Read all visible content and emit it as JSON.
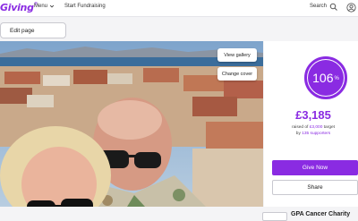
{
  "header": {
    "logo": "Giving",
    "menu_label": "Menu",
    "start_fundraising": "Start Fundraising",
    "search_label": "Search"
  },
  "toolbar": {
    "edit_page": "Edit page"
  },
  "photo": {
    "view_gallery": "View gallery",
    "change_cover": "Change cover"
  },
  "progress": {
    "percent_value": 106,
    "percent_number": "106",
    "percent_sign": "%",
    "raised": "£3,185",
    "target_prefix": "raised of ",
    "target_amount": "£3,000",
    "target_suffix": " target",
    "by_prefix": "by ",
    "supporters": "135 supporters"
  },
  "actions": {
    "give_now": "Give Now",
    "share": "Share"
  },
  "charity": {
    "name": "GPA Cancer Charity"
  },
  "colors": {
    "brand": "#8a2be2",
    "ring_track": "#e9dcf7"
  }
}
